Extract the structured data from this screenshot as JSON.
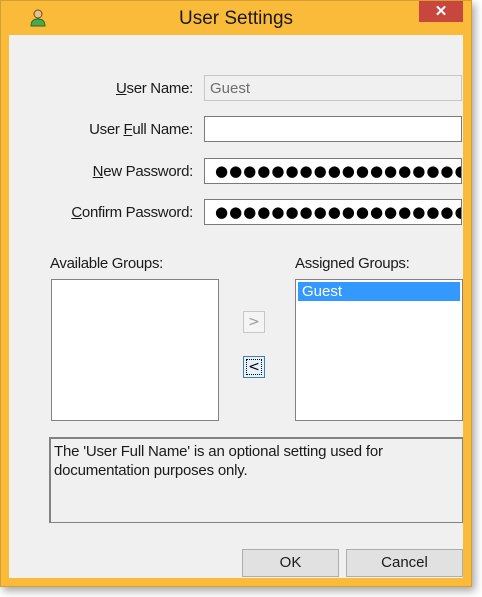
{
  "window": {
    "title": "User Settings",
    "close_glyph": "✕"
  },
  "form": {
    "user_name": {
      "label_underline": "U",
      "label_rest": "ser Name:",
      "value": "Guest"
    },
    "full_name": {
      "label_pre": "User ",
      "label_underline": "F",
      "label_rest": "ull Name:",
      "value": ""
    },
    "new_password": {
      "label_underline": "N",
      "label_rest": "ew Password:",
      "masked": "●●●●●●●●●●●●●●●●●●"
    },
    "confirm_password": {
      "label_underline": "C",
      "label_rest": "onfirm Password:",
      "masked": "●●●●●●●●●●●●●●●●●●"
    }
  },
  "groups": {
    "available_label": "Available Groups:",
    "assigned_label": "Assigned Groups:",
    "available": [],
    "assigned": [
      "Guest"
    ],
    "add_glyph": ">",
    "remove_glyph": "<"
  },
  "info_text": "The 'User Full Name' is an optional setting used for documentation purposes only.",
  "buttons": {
    "ok": "OK",
    "cancel": "Cancel"
  },
  "colors": {
    "title_bar": "#fbbb3a",
    "close": "#c7463e",
    "selection": "#3399ff"
  },
  "icons": {
    "app": "user-icon",
    "close": "close-icon"
  }
}
